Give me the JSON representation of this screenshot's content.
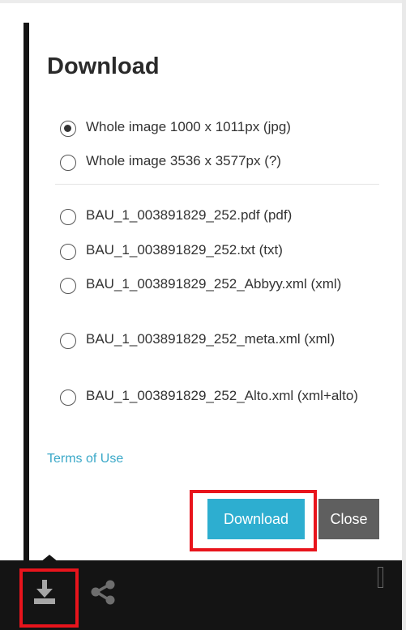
{
  "dialog": {
    "title": "Download",
    "image_options": [
      {
        "label": "Whole image 1000 x 1011px (jpg)",
        "selected": true
      },
      {
        "label": "Whole image 3536 x 3577px (?)",
        "selected": false
      }
    ],
    "file_options": [
      {
        "label": "BAU_1_003891829_252.pdf (pdf)",
        "selected": false
      },
      {
        "label": "BAU_1_003891829_252.txt (txt)",
        "selected": false
      },
      {
        "label": "BAU_1_003891829_252_Abbyy.xml (xml)",
        "selected": false
      },
      {
        "label": "BAU_1_003891829_252_meta.xml (xml)",
        "selected": false
      },
      {
        "label": "BAU_1_003891829_252_Alto.xml (xml+alto)",
        "selected": false
      }
    ],
    "terms_link": "Terms of Use",
    "download_button": "Download",
    "close_button": "Close"
  },
  "toolbar": {
    "icons": [
      "download-icon",
      "share-icon"
    ]
  },
  "colors": {
    "accent": "#2daed0",
    "close_button": "#5f5f5f",
    "highlight": "#e8141c",
    "toolbar": "#141414",
    "link": "#3aa8c8"
  }
}
